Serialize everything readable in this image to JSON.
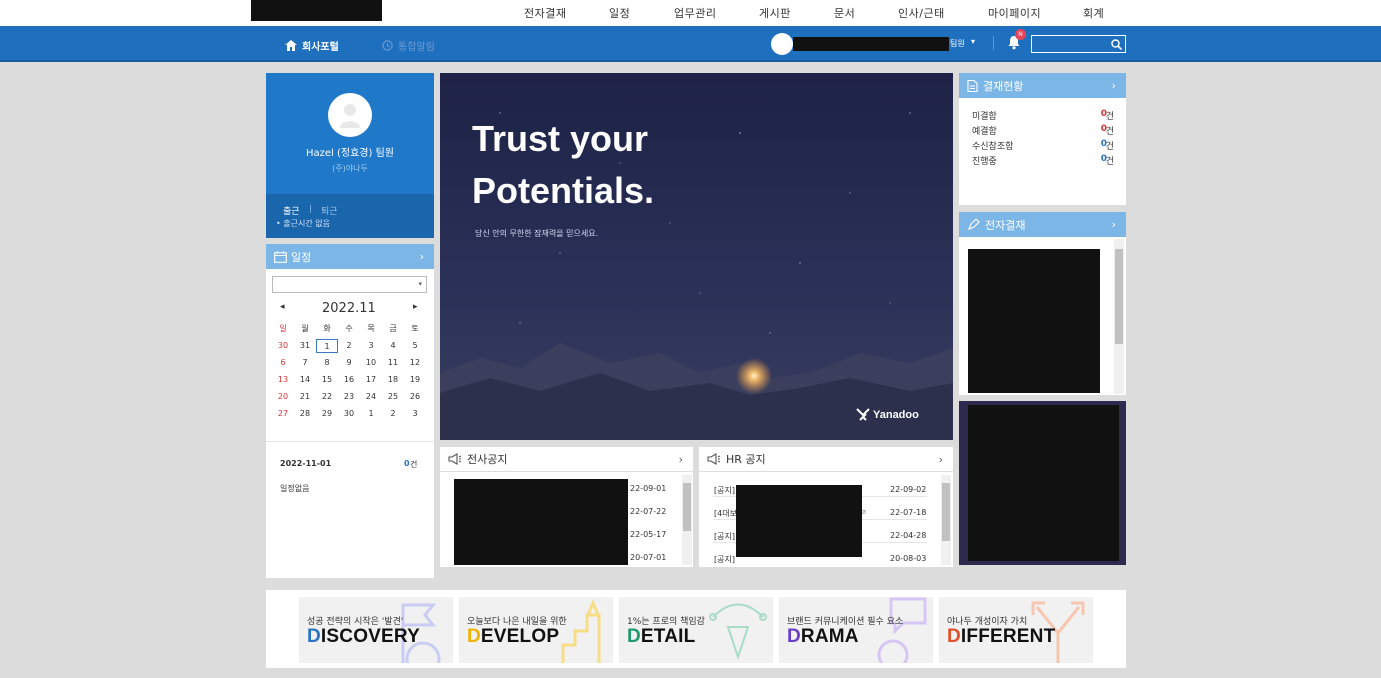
{
  "top_nav": {
    "items": [
      "전자결재",
      "일정",
      "업무관리",
      "게시판",
      "문서",
      "인사/근태",
      "마이페이지",
      "회계"
    ]
  },
  "sub_nav": {
    "tab_portal": "회사포털",
    "tab_integrated": "통합알림",
    "user_suffix": "팀원",
    "notification_badge": "N",
    "search_placeholder": ""
  },
  "profile": {
    "name": "Hazel (정효경) 팀원",
    "company": "(주)야나두",
    "clock_in": "출근",
    "separator": "|",
    "clock_out": "퇴근",
    "clock_in_time": "• 출근시간 없음"
  },
  "schedule": {
    "title": "일정",
    "select_value": "",
    "month": "2022.11",
    "weekdays": [
      "일",
      "월",
      "화",
      "수",
      "목",
      "금",
      "토"
    ],
    "weeks": [
      [
        "30",
        "31",
        "1",
        "2",
        "3",
        "4",
        "5"
      ],
      [
        "6",
        "7",
        "8",
        "9",
        "10",
        "11",
        "12"
      ],
      [
        "13",
        "14",
        "15",
        "16",
        "17",
        "18",
        "19"
      ],
      [
        "20",
        "21",
        "22",
        "23",
        "24",
        "25",
        "26"
      ],
      [
        "27",
        "28",
        "29",
        "30",
        "1",
        "2",
        "3"
      ]
    ],
    "selected_date": "2022-11-01",
    "count": "0",
    "count_unit": "건",
    "empty_text": "일정없음"
  },
  "hero": {
    "line1": "Trust your",
    "line2": "Potentials.",
    "subtitle": "당신 안의 무한한 잠재력을 믿으세요.",
    "brand": "Yanadoo"
  },
  "approval_status": {
    "title": "결재현황",
    "rows": [
      {
        "label": "미결함",
        "count": "0",
        "unit": "건",
        "color": "#d8343a"
      },
      {
        "label": "예결함",
        "count": "0",
        "unit": "건",
        "color": "#d8343a"
      },
      {
        "label": "수신참조함",
        "count": "0",
        "unit": "건",
        "color": "#2a73c4"
      },
      {
        "label": "진행중",
        "count": "0",
        "unit": "건",
        "color": "#2a73c4"
      }
    ]
  },
  "e_approval": {
    "title": "전자결재"
  },
  "company_notice": {
    "title": "전사공지",
    "dates": [
      "22-09-01",
      "22-07-22",
      "22-05-17",
      "20-07-01"
    ]
  },
  "hr_notice": {
    "title": "HR 공지",
    "rows": [
      {
        "prefix": "[공지]",
        "date": "22-09-02"
      },
      {
        "prefix": "[4대보",
        "date": "22-07-18"
      },
      {
        "prefix": "[공지]",
        "date": "22-04-28"
      },
      {
        "prefix": "[공지]",
        "date": "20-08-03"
      }
    ]
  },
  "banners": [
    {
      "sub": "성공 전략의 시작은 '발견'",
      "initial": "D",
      "rest": "ISCOVERY",
      "color": "#2a73c4"
    },
    {
      "sub": "오늘보다 나은 내일을 위한",
      "initial": "D",
      "rest": "EVELOP",
      "color": "#f0b400"
    },
    {
      "sub": "1%는 프로의 책임감",
      "initial": "D",
      "rest": "ETAIL",
      "color": "#1f9a6a"
    },
    {
      "sub": "브랜드 커뮤니케이션 필수 요소",
      "initial": "D",
      "rest": "RAMA",
      "color": "#6a3fc8"
    },
    {
      "sub": "야나두 개성이자 가치",
      "initial": "D",
      "rest": "IFFERENT",
      "color": "#e0502a"
    }
  ],
  "colors": {
    "brand_blue": "#1f6fbf",
    "header_light": "#7cb6e6",
    "hero_bg": "#23294f"
  }
}
